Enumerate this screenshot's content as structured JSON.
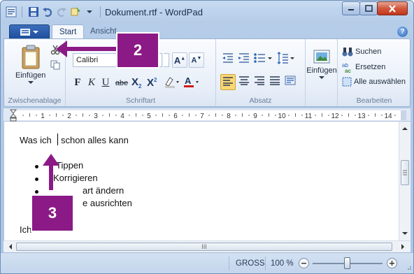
{
  "window": {
    "title": "Dokument.rtf - WordPad",
    "minimize_label": "–",
    "maximize_label": "☐",
    "close_label": "X"
  },
  "tabs": [
    {
      "label": "Start",
      "active": true
    },
    {
      "label": "Ansicht",
      "active": false
    }
  ],
  "groups": {
    "clipboard": {
      "label": "Zwischenablage",
      "paste_label": "Einfügen"
    },
    "font": {
      "label": "Schriftart",
      "font_name": "Calibri",
      "bold": "F",
      "italic": "K",
      "underline": "U",
      "strike": "abe"
    },
    "paragraph": {
      "label": "Absatz"
    },
    "insert": {
      "label": "Einfügen"
    },
    "edit": {
      "label": "Bearbeiten",
      "find": "Suchen",
      "replace": "Ersetzen",
      "select_all": "Alle auswählen"
    }
  },
  "ruler": {
    "numbers": [
      "1",
      "2",
      "3",
      "4",
      "5",
      "6",
      "7",
      "8",
      "9",
      "10",
      "11",
      "12",
      "13",
      "14"
    ]
  },
  "document": {
    "line1_a": "Was ich",
    "line1_b": "schon alles kann",
    "bullets": [
      "Tippen",
      "Korrigieren",
      "art ändern",
      "e ausrichten"
    ],
    "last_line": "Ich"
  },
  "hscroll_grip": "III",
  "status": {
    "caps": "GROSS",
    "zoom": "100 %",
    "zoom_level_percent": 100
  },
  "callouts": [
    {
      "number": "2"
    },
    {
      "number": "3"
    }
  ],
  "colors": {
    "callout": "#8b1a86",
    "accent": "#2c64b6"
  }
}
